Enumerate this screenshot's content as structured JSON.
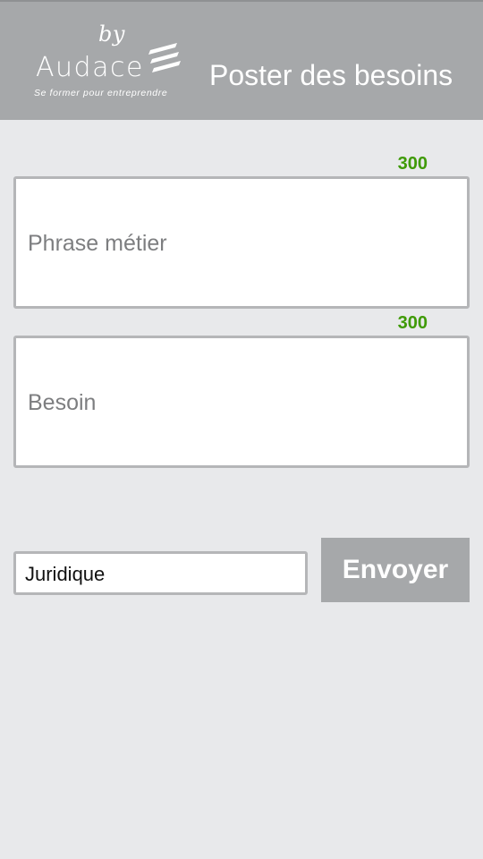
{
  "header": {
    "logo": {
      "by": "by",
      "brand": "Audace",
      "tagline": "Se former pour entreprendre"
    },
    "title": "Poster des besoins",
    "background_color": "#a6a8aa"
  },
  "form": {
    "phrase_metier": {
      "counter": "300",
      "placeholder": "Phrase métier"
    },
    "besoin": {
      "counter": "300",
      "placeholder": "Besoin"
    },
    "category": {
      "selected": "Juridique"
    },
    "submit_label": "Envoyer"
  },
  "colors": {
    "counter": "#3f9a07",
    "button": "#a6a8aa",
    "background": "#e8e9eb"
  }
}
